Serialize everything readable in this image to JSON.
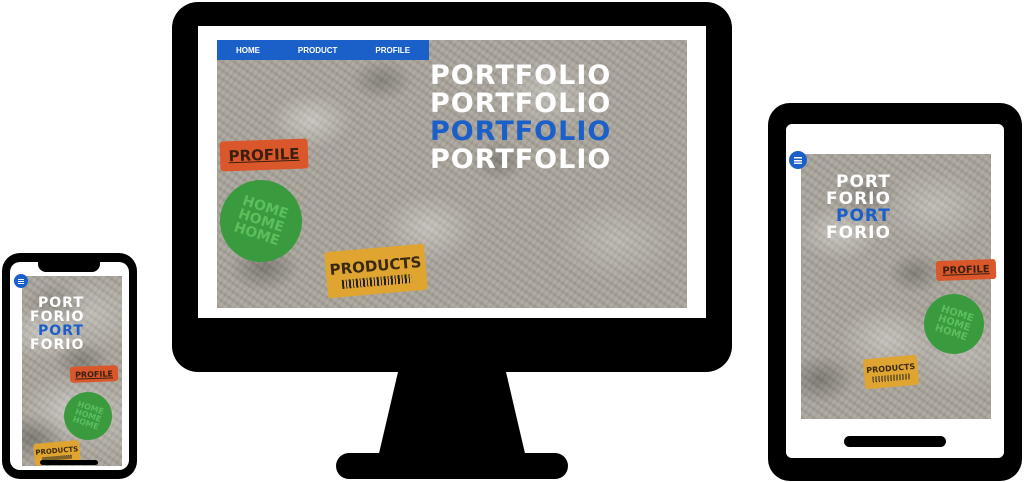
{
  "colors": {
    "accent": "#1b5fc9",
    "orange": "#d9572b",
    "green": "#3a9a3e",
    "yellow": "#e0a531"
  },
  "desktop": {
    "nav": {
      "home": "HOME",
      "product": "PRODUCT",
      "profile": "PROFILE"
    },
    "title_lines": [
      "PORTFOLIO",
      "PORTFOLIO",
      "PORTFOLIO",
      "PORTFOLIO"
    ],
    "stickers": {
      "profile": "PROFILE",
      "home": [
        "HOME",
        "HOME",
        "HOME"
      ],
      "products": "PRODUCTS"
    }
  },
  "tablet": {
    "title_lines": [
      "PORT",
      "FORIO",
      "PORT",
      "FORIO"
    ],
    "stickers": {
      "profile": "PROFILE",
      "home": [
        "HOME",
        "HOME",
        "HOME"
      ],
      "products": "PRODUCTS"
    },
    "menu_icon": "hamburger-menu-icon"
  },
  "phone": {
    "title_lines": [
      "PORT",
      "FORIO",
      "PORT",
      "FORIO"
    ],
    "stickers": {
      "profile": "PROFILE",
      "home": [
        "HOME",
        "HOME",
        "HOME"
      ],
      "products": "PRODUCTS"
    },
    "menu_icon": "hamburger-menu-icon"
  }
}
